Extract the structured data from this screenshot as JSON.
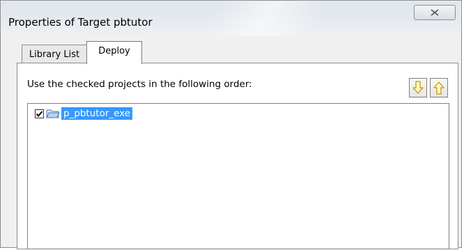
{
  "window": {
    "title": "Properties of Target pbtutor"
  },
  "tabs": [
    {
      "label": "Library List",
      "active": false
    },
    {
      "label": "Deploy",
      "active": true
    }
  ],
  "deploy": {
    "instruction": "Use the checked projects in the following order:",
    "move_down_icon": "arrow-down-icon",
    "move_up_icon": "arrow-up-icon",
    "projects": [
      {
        "label": "p_pbtutor_exe",
        "checked": true,
        "selected": true,
        "icon": "folder-icon"
      }
    ]
  },
  "colors": {
    "selection": "#3399ff",
    "arrow": "#e3b81d"
  }
}
